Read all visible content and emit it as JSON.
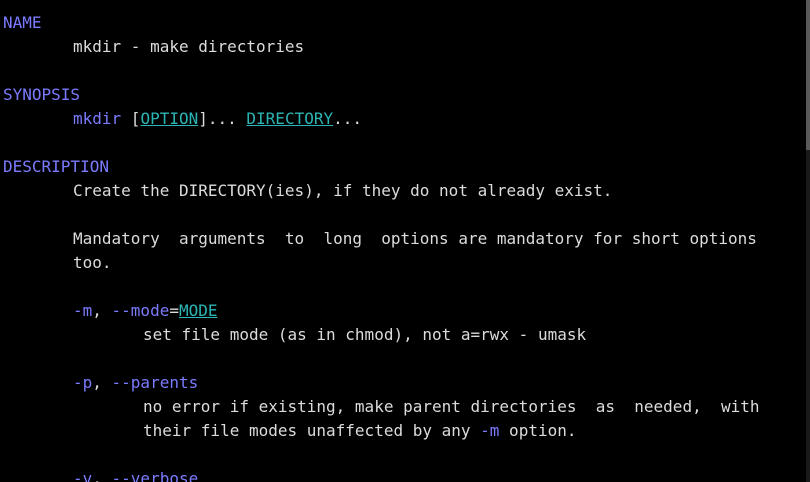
{
  "man": {
    "name_heading": "NAME",
    "name_line": "mkdir - make directories",
    "synopsis_heading": "SYNOPSIS",
    "synopsis": {
      "cmd": "mkdir",
      "open_bracket": " [",
      "option": "OPTION",
      "after_option": "]... ",
      "directory": "DIRECTORY",
      "ellipsis": "..."
    },
    "description_heading": "DESCRIPTION",
    "desc_line1": "Create the DIRECTORY(ies), if they do not already exist.",
    "desc_line2": "Mandatory  arguments  to  long  options are mandatory for short options",
    "desc_line3": "too.",
    "opt_mode": {
      "short": "-m",
      "sep": ", ",
      "long": "--mode",
      "eq": "=",
      "arg": "MODE",
      "desc": "set file mode (as in chmod), not a=rwx - umask"
    },
    "opt_parents": {
      "short": "-p",
      "sep": ", ",
      "long": "--parents",
      "desc1": "no error if existing, make parent directories  as  needed,  with",
      "desc2_before": "their file modes unaffected by any ",
      "desc2_flag": "-m",
      "desc2_after": " option."
    },
    "opt_verbose": {
      "short": "-v",
      "sep": ", ",
      "long": "--verbose"
    }
  },
  "colors": {
    "background": "#000000",
    "text": "#dcdcdc",
    "heading": "#7b7bff",
    "underline": "#2bb5b5"
  }
}
